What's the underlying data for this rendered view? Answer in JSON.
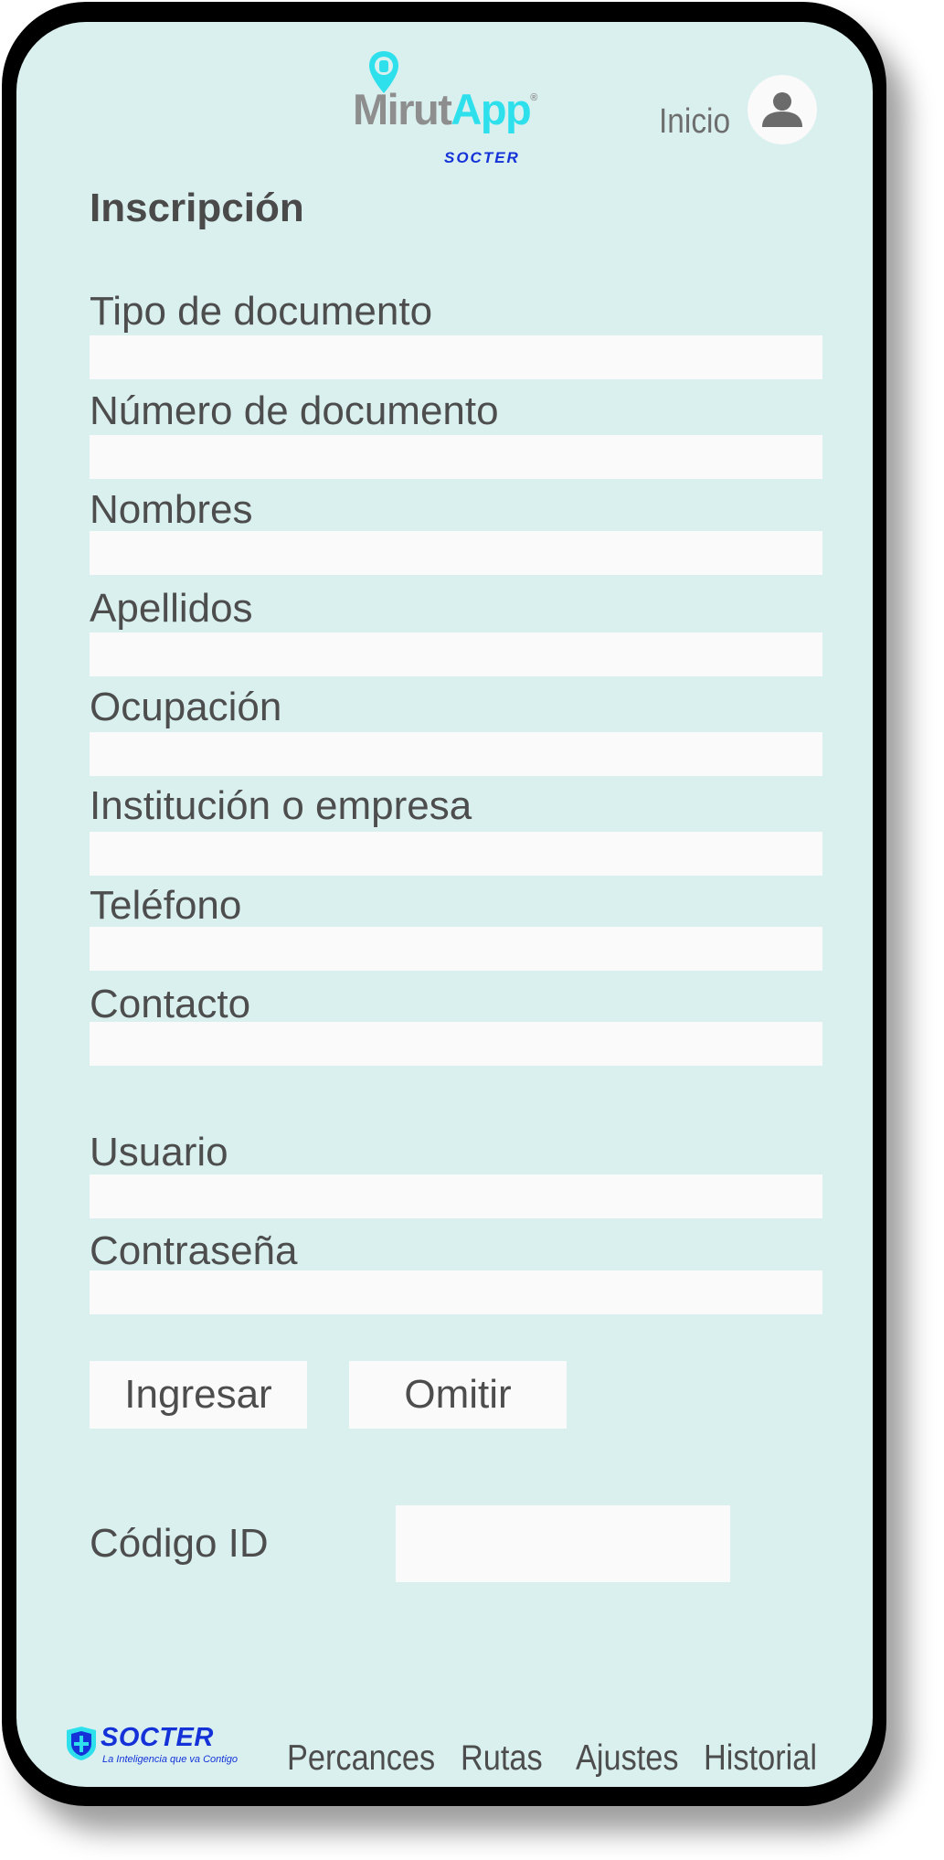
{
  "header": {
    "logo_main": "Mirut",
    "logo_accent": "App",
    "logo_registered": "®",
    "logo_sub": "SOCTER",
    "inicio_label": "Inicio"
  },
  "form": {
    "title": "Inscripción",
    "fields": [
      {
        "label": "Tipo de documento",
        "value": ""
      },
      {
        "label": "Número de documento",
        "value": ""
      },
      {
        "label": "Nombres",
        "value": ""
      },
      {
        "label": "Apellidos",
        "value": ""
      },
      {
        "label": "Ocupación",
        "value": ""
      },
      {
        "label": "Institución o empresa",
        "value": ""
      },
      {
        "label": "Teléfono",
        "value": ""
      },
      {
        "label": "Contacto",
        "value": ""
      },
      {
        "label": "Usuario",
        "value": ""
      },
      {
        "label": "Contraseña",
        "value": ""
      }
    ],
    "submit_label": "Ingresar",
    "skip_label": "Omitir",
    "code_label": "Código ID",
    "code_value": ""
  },
  "footer": {
    "brand_name": "SOCTER",
    "brand_tagline": "La Inteligencia que va Contigo",
    "nav": [
      "Percances",
      "Rutas",
      "Ajustes",
      "Historial"
    ]
  },
  "colors": {
    "screen_bg": "#d9f0ef",
    "frame": "#000000",
    "input_bg": "#fafafa",
    "text": "#4d4d4d",
    "accent_cyan": "#2ee0ec",
    "brand_blue": "#1432d8"
  }
}
